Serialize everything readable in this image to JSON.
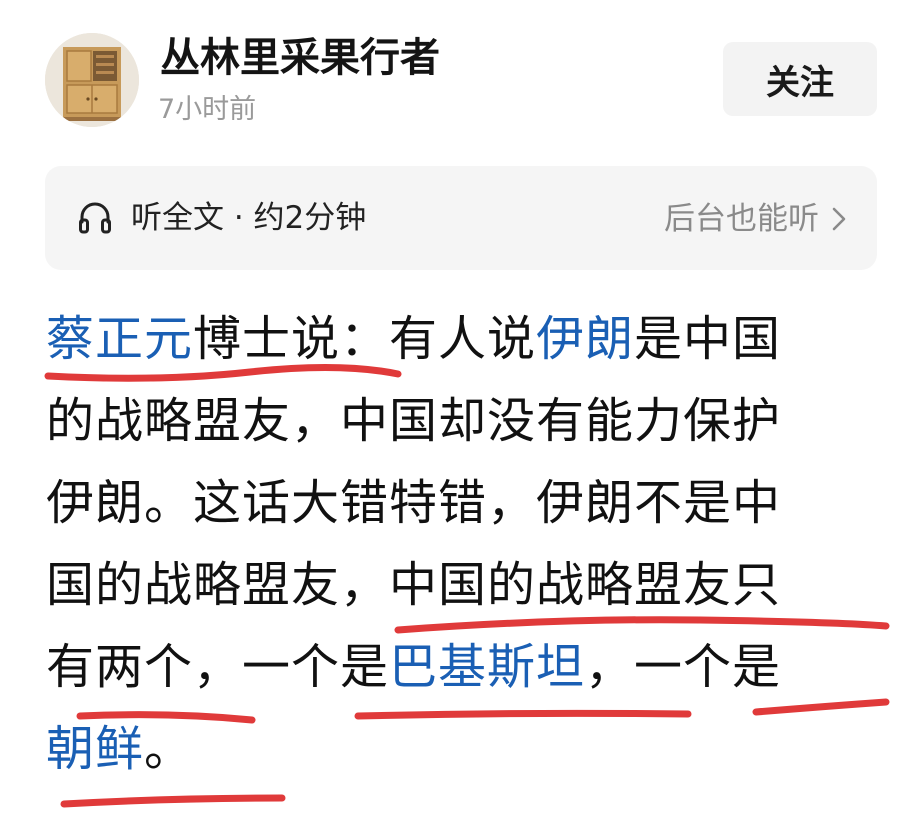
{
  "author": {
    "name": "丛林里采果行者",
    "time": "7小时前",
    "avatar_icon": "cabinet-avatar-icon"
  },
  "follow": {
    "label": "关注"
  },
  "listen": {
    "icon": "headphone-icon",
    "label": "听全文 · 约2分钟",
    "background_label": "后台也能听",
    "chevron_icon": "chevron-right-icon"
  },
  "article": {
    "lines": [
      [
        {
          "text": "蔡正元",
          "link": true
        },
        {
          "text": "博士说：有人说",
          "link": false
        },
        {
          "text": "伊朗",
          "link": true
        },
        {
          "text": "是中国",
          "link": false
        }
      ],
      [
        {
          "text": "的战略盟友，中国却没有能力保护",
          "link": false
        }
      ],
      [
        {
          "text": "伊朗。这话大错特错，伊朗不是中",
          "link": false
        }
      ],
      [
        {
          "text": "国的战略盟友，中国的战略盟友只",
          "link": false
        }
      ],
      [
        {
          "text": "有两个，一个是",
          "link": false
        },
        {
          "text": "巴基斯坦",
          "link": true
        },
        {
          "text": "，一个是",
          "link": false
        }
      ],
      [
        {
          "text": "朝鲜",
          "link": true
        },
        {
          "text": "。",
          "link": false
        }
      ]
    ]
  },
  "colors": {
    "link": "#1a5fb4",
    "annotation": "#e03a3a",
    "muted": "#9a9a9a"
  }
}
